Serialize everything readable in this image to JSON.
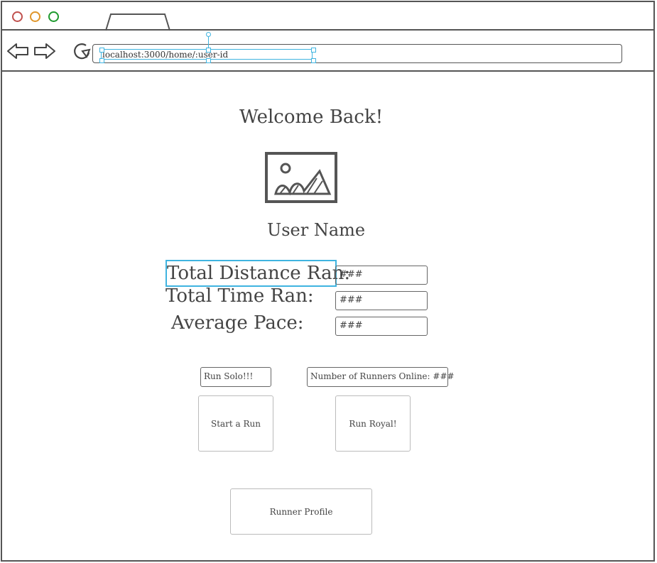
{
  "browser": {
    "url": "localhost:3000/home/:user-id"
  },
  "page": {
    "title": "Welcome Back!",
    "user_name": "User Name",
    "avatar_icon": "image-placeholder-icon"
  },
  "stats": [
    {
      "label": "Total Distance Ran:",
      "value": "###"
    },
    {
      "label": "Total Time Ran:",
      "value": "###"
    },
    {
      "label": "Average Pace:",
      "value": "###"
    }
  ],
  "run_modes": {
    "solo_label": "Run Solo!!!",
    "online_label": "Number of Runners Online: ###",
    "start_button": "Start a Run",
    "royal_button": "Run Royal!"
  },
  "profile_button": "Runner Profile"
}
